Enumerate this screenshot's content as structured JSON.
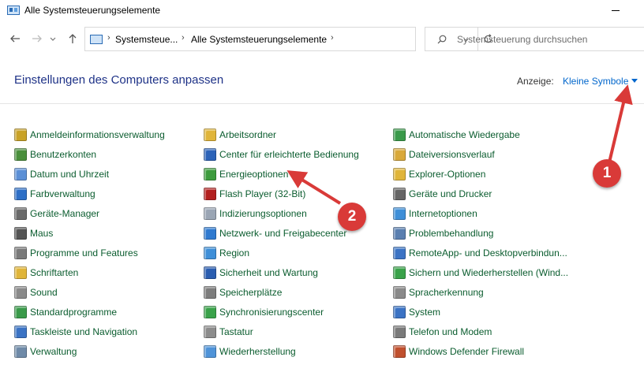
{
  "window": {
    "title": "Alle Systemsteuerungselemente"
  },
  "address": {
    "crumbs": [
      "Systemsteue...",
      "Alle Systemsteuerungselemente"
    ],
    "search_placeholder": "Systemsteuerung durchsuchen"
  },
  "header": {
    "title": "Einstellungen des Computers anpassen",
    "view_label": "Anzeige:",
    "view_value": "Kleine Symbole"
  },
  "icons": {
    "back": "arrow-left-icon",
    "forward": "arrow-right-icon",
    "recent": "chevron-down-icon",
    "up": "arrow-up-icon",
    "refresh": "refresh-icon",
    "search": "search-icon"
  },
  "columns": [
    [
      {
        "label": "Anmeldeinformationsverwaltung",
        "color": "#c9a227"
      },
      {
        "label": "Benutzerkonten",
        "color": "#4a8f3c"
      },
      {
        "label": "Datum und Uhrzeit",
        "color": "#5b8fd6"
      },
      {
        "label": "Farbverwaltung",
        "color": "#2e6fc7"
      },
      {
        "label": "Geräte-Manager",
        "color": "#6a6a6a"
      },
      {
        "label": "Maus",
        "color": "#555555"
      },
      {
        "label": "Programme und Features",
        "color": "#7a7a7a"
      },
      {
        "label": "Schriftarten",
        "color": "#e0b53a"
      },
      {
        "label": "Sound",
        "color": "#8a8a8a"
      },
      {
        "label": "Standardprogramme",
        "color": "#3a9a4a"
      },
      {
        "label": "Taskleiste und Navigation",
        "color": "#3b73c4"
      },
      {
        "label": "Verwaltung",
        "color": "#6f8aa8"
      }
    ],
    [
      {
        "label": "Arbeitsordner",
        "color": "#e0b53a"
      },
      {
        "label": "Center für erleichterte Bedienung",
        "color": "#2c63b8"
      },
      {
        "label": "Energieoptionen",
        "color": "#3d9b3d"
      },
      {
        "label": "Flash Player (32-Bit)",
        "color": "#b3201f"
      },
      {
        "label": "Indizierungsoptionen",
        "color": "#9aa5b4"
      },
      {
        "label": "Netzwerk- und Freigabecenter",
        "color": "#2f7ad0"
      },
      {
        "label": "Region",
        "color": "#3f8fd8"
      },
      {
        "label": "Sicherheit und Wartung",
        "color": "#2a5db0"
      },
      {
        "label": "Speicherplätze",
        "color": "#7d7d7d"
      },
      {
        "label": "Synchronisierungscenter",
        "color": "#3aa24a"
      },
      {
        "label": "Tastatur",
        "color": "#8c8c8c"
      },
      {
        "label": "Wiederherstellung",
        "color": "#4f93d8"
      }
    ],
    [
      {
        "label": "Automatische Wiedergabe",
        "color": "#3a9a4a"
      },
      {
        "label": "Dateiversionsverlauf",
        "color": "#d9a93a"
      },
      {
        "label": "Explorer-Optionen",
        "color": "#e0b53a"
      },
      {
        "label": "Geräte und Drucker",
        "color": "#666666"
      },
      {
        "label": "Internetoptionen",
        "color": "#3f8fd8"
      },
      {
        "label": "Problembehandlung",
        "color": "#5a7fb0"
      },
      {
        "label": "RemoteApp- und Desktopverbindun...",
        "color": "#3b73c4"
      },
      {
        "label": "Sichern und Wiederherstellen (Wind...",
        "color": "#3aa24a"
      },
      {
        "label": "Spracherkennung",
        "color": "#8a8a8a"
      },
      {
        "label": "System",
        "color": "#3b73c4"
      },
      {
        "label": "Telefon und Modem",
        "color": "#7a7a7a"
      },
      {
        "label": "Windows Defender Firewall",
        "color": "#c0502e"
      }
    ]
  ],
  "annotations": [
    {
      "number": "1"
    },
    {
      "number": "2"
    }
  ]
}
